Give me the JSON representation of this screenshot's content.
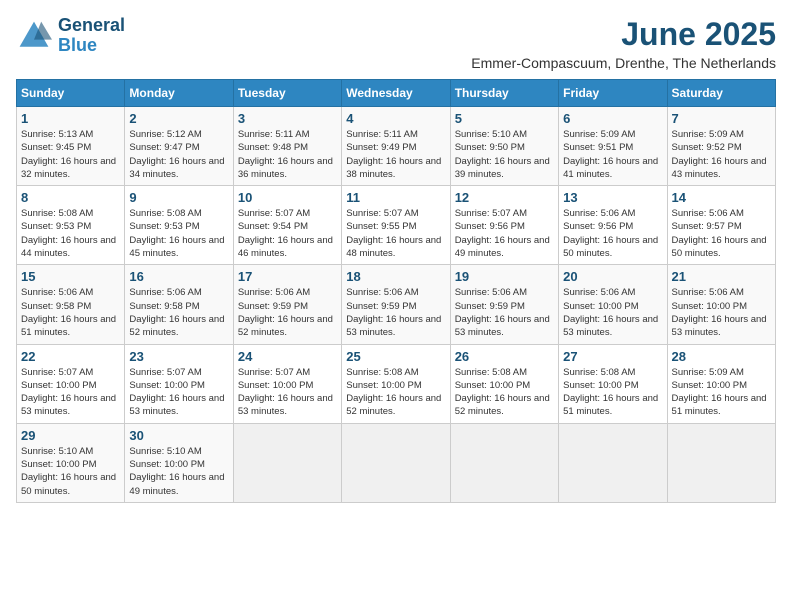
{
  "logo": {
    "line1": "General",
    "line2": "Blue"
  },
  "title": "June 2025",
  "subtitle": "Emmer-Compascuum, Drenthe, The Netherlands",
  "days_of_week": [
    "Sunday",
    "Monday",
    "Tuesday",
    "Wednesday",
    "Thursday",
    "Friday",
    "Saturday"
  ],
  "weeks": [
    [
      {
        "day": "1",
        "sunrise": "Sunrise: 5:13 AM",
        "sunset": "Sunset: 9:45 PM",
        "daylight": "Daylight: 16 hours and 32 minutes."
      },
      {
        "day": "2",
        "sunrise": "Sunrise: 5:12 AM",
        "sunset": "Sunset: 9:47 PM",
        "daylight": "Daylight: 16 hours and 34 minutes."
      },
      {
        "day": "3",
        "sunrise": "Sunrise: 5:11 AM",
        "sunset": "Sunset: 9:48 PM",
        "daylight": "Daylight: 16 hours and 36 minutes."
      },
      {
        "day": "4",
        "sunrise": "Sunrise: 5:11 AM",
        "sunset": "Sunset: 9:49 PM",
        "daylight": "Daylight: 16 hours and 38 minutes."
      },
      {
        "day": "5",
        "sunrise": "Sunrise: 5:10 AM",
        "sunset": "Sunset: 9:50 PM",
        "daylight": "Daylight: 16 hours and 39 minutes."
      },
      {
        "day": "6",
        "sunrise": "Sunrise: 5:09 AM",
        "sunset": "Sunset: 9:51 PM",
        "daylight": "Daylight: 16 hours and 41 minutes."
      },
      {
        "day": "7",
        "sunrise": "Sunrise: 5:09 AM",
        "sunset": "Sunset: 9:52 PM",
        "daylight": "Daylight: 16 hours and 43 minutes."
      }
    ],
    [
      {
        "day": "8",
        "sunrise": "Sunrise: 5:08 AM",
        "sunset": "Sunset: 9:53 PM",
        "daylight": "Daylight: 16 hours and 44 minutes."
      },
      {
        "day": "9",
        "sunrise": "Sunrise: 5:08 AM",
        "sunset": "Sunset: 9:53 PM",
        "daylight": "Daylight: 16 hours and 45 minutes."
      },
      {
        "day": "10",
        "sunrise": "Sunrise: 5:07 AM",
        "sunset": "Sunset: 9:54 PM",
        "daylight": "Daylight: 16 hours and 46 minutes."
      },
      {
        "day": "11",
        "sunrise": "Sunrise: 5:07 AM",
        "sunset": "Sunset: 9:55 PM",
        "daylight": "Daylight: 16 hours and 48 minutes."
      },
      {
        "day": "12",
        "sunrise": "Sunrise: 5:07 AM",
        "sunset": "Sunset: 9:56 PM",
        "daylight": "Daylight: 16 hours and 49 minutes."
      },
      {
        "day": "13",
        "sunrise": "Sunrise: 5:06 AM",
        "sunset": "Sunset: 9:56 PM",
        "daylight": "Daylight: 16 hours and 50 minutes."
      },
      {
        "day": "14",
        "sunrise": "Sunrise: 5:06 AM",
        "sunset": "Sunset: 9:57 PM",
        "daylight": "Daylight: 16 hours and 50 minutes."
      }
    ],
    [
      {
        "day": "15",
        "sunrise": "Sunrise: 5:06 AM",
        "sunset": "Sunset: 9:58 PM",
        "daylight": "Daylight: 16 hours and 51 minutes."
      },
      {
        "day": "16",
        "sunrise": "Sunrise: 5:06 AM",
        "sunset": "Sunset: 9:58 PM",
        "daylight": "Daylight: 16 hours and 52 minutes."
      },
      {
        "day": "17",
        "sunrise": "Sunrise: 5:06 AM",
        "sunset": "Sunset: 9:59 PM",
        "daylight": "Daylight: 16 hours and 52 minutes."
      },
      {
        "day": "18",
        "sunrise": "Sunrise: 5:06 AM",
        "sunset": "Sunset: 9:59 PM",
        "daylight": "Daylight: 16 hours and 53 minutes."
      },
      {
        "day": "19",
        "sunrise": "Sunrise: 5:06 AM",
        "sunset": "Sunset: 9:59 PM",
        "daylight": "Daylight: 16 hours and 53 minutes."
      },
      {
        "day": "20",
        "sunrise": "Sunrise: 5:06 AM",
        "sunset": "Sunset: 10:00 PM",
        "daylight": "Daylight: 16 hours and 53 minutes."
      },
      {
        "day": "21",
        "sunrise": "Sunrise: 5:06 AM",
        "sunset": "Sunset: 10:00 PM",
        "daylight": "Daylight: 16 hours and 53 minutes."
      }
    ],
    [
      {
        "day": "22",
        "sunrise": "Sunrise: 5:07 AM",
        "sunset": "Sunset: 10:00 PM",
        "daylight": "Daylight: 16 hours and 53 minutes."
      },
      {
        "day": "23",
        "sunrise": "Sunrise: 5:07 AM",
        "sunset": "Sunset: 10:00 PM",
        "daylight": "Daylight: 16 hours and 53 minutes."
      },
      {
        "day": "24",
        "sunrise": "Sunrise: 5:07 AM",
        "sunset": "Sunset: 10:00 PM",
        "daylight": "Daylight: 16 hours and 53 minutes."
      },
      {
        "day": "25",
        "sunrise": "Sunrise: 5:08 AM",
        "sunset": "Sunset: 10:00 PM",
        "daylight": "Daylight: 16 hours and 52 minutes."
      },
      {
        "day": "26",
        "sunrise": "Sunrise: 5:08 AM",
        "sunset": "Sunset: 10:00 PM",
        "daylight": "Daylight: 16 hours and 52 minutes."
      },
      {
        "day": "27",
        "sunrise": "Sunrise: 5:08 AM",
        "sunset": "Sunset: 10:00 PM",
        "daylight": "Daylight: 16 hours and 51 minutes."
      },
      {
        "day": "28",
        "sunrise": "Sunrise: 5:09 AM",
        "sunset": "Sunset: 10:00 PM",
        "daylight": "Daylight: 16 hours and 51 minutes."
      }
    ],
    [
      {
        "day": "29",
        "sunrise": "Sunrise: 5:10 AM",
        "sunset": "Sunset: 10:00 PM",
        "daylight": "Daylight: 16 hours and 50 minutes."
      },
      {
        "day": "30",
        "sunrise": "Sunrise: 5:10 AM",
        "sunset": "Sunset: 10:00 PM",
        "daylight": "Daylight: 16 hours and 49 minutes."
      },
      null,
      null,
      null,
      null,
      null
    ]
  ]
}
